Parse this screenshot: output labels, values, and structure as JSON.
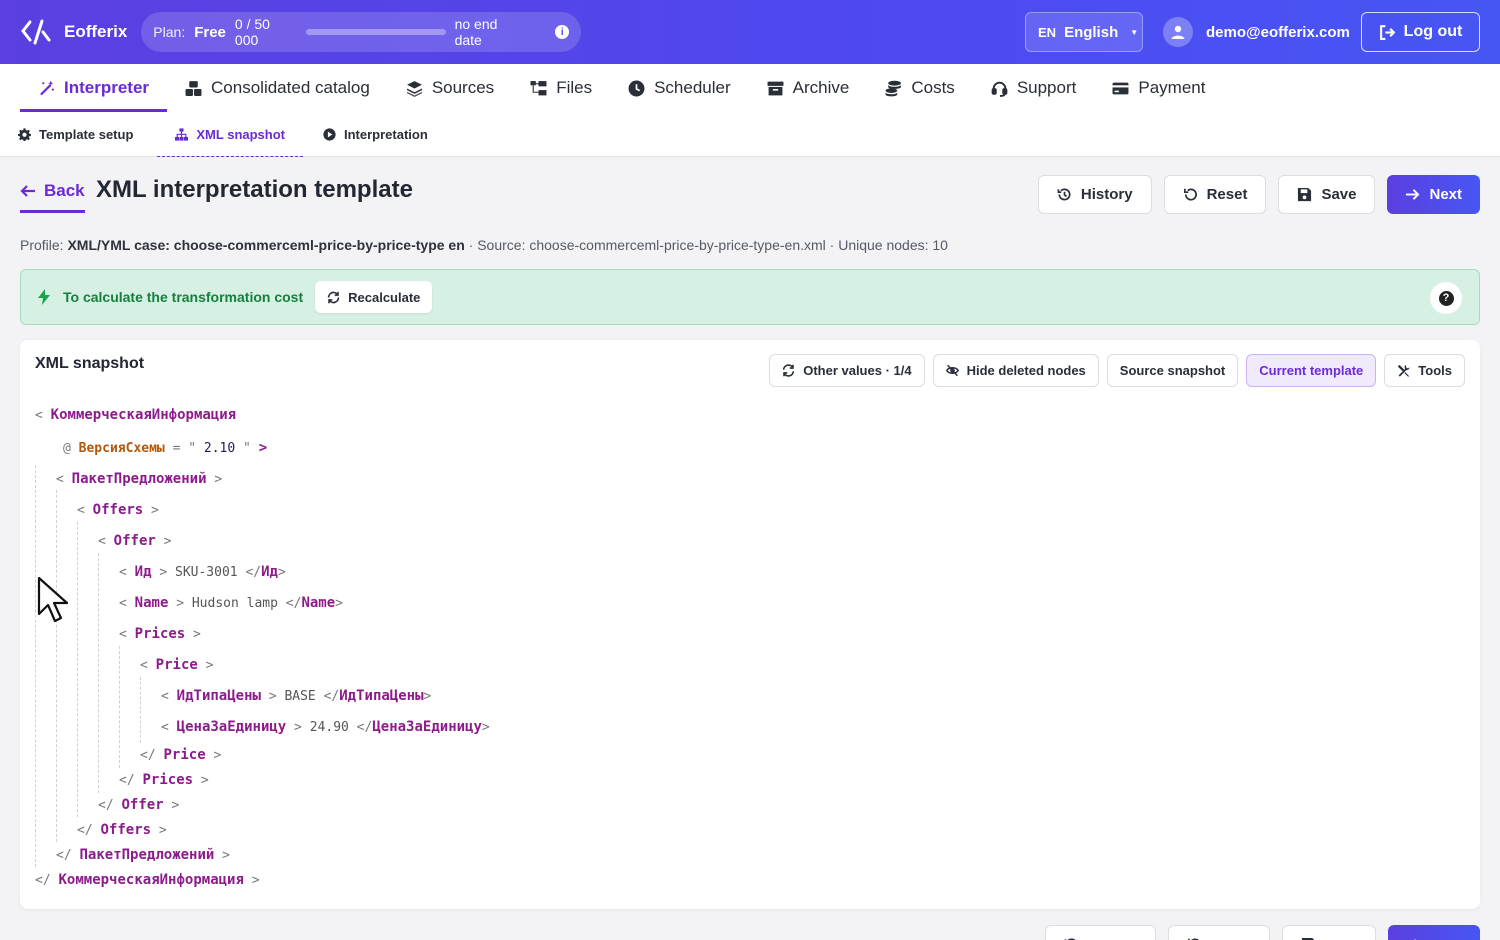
{
  "header": {
    "app_name": "Eofferix",
    "plan_label": "Plan:",
    "plan_name": "Free",
    "usage": "0 / 50 000",
    "usage_fraction": 0,
    "expiry": "no end date",
    "lang_code": "EN",
    "lang_name": "English",
    "user_email": "demo@eofferix.com",
    "logout_label": "Log out"
  },
  "main_nav": [
    {
      "label": "Interpreter",
      "icon": "magic-wand-icon",
      "active": true
    },
    {
      "label": "Consolidated catalog",
      "icon": "cubes-icon"
    },
    {
      "label": "Sources",
      "icon": "layers-icon"
    },
    {
      "label": "Files",
      "icon": "folder-tree-icon"
    },
    {
      "label": "Scheduler",
      "icon": "clock-icon"
    },
    {
      "label": "Archive",
      "icon": "archive-box-icon"
    },
    {
      "label": "Costs",
      "icon": "coins-icon"
    },
    {
      "label": "Support",
      "icon": "headset-icon"
    },
    {
      "label": "Payment",
      "icon": "credit-card-icon"
    }
  ],
  "sub_nav": [
    {
      "label": "Template setup",
      "icon": "gear-icon"
    },
    {
      "label": "XML snapshot",
      "icon": "sitemap-icon",
      "active": true
    },
    {
      "label": "Interpretation",
      "icon": "play-circle-icon"
    }
  ],
  "page": {
    "back_label": "Back",
    "title": "XML interpretation template",
    "actions": {
      "history": "History",
      "reset": "Reset",
      "save": "Save",
      "next": "Next"
    },
    "profile_label": "Profile:",
    "profile_value": "XML/YML case: choose-commerceml-price-by-price-type en",
    "source_text": "· Source: choose-commerceml-price-by-price-type-en.xml · Unique nodes: 10"
  },
  "alert": {
    "text": "To calculate the transformation cost",
    "button": "Recalculate",
    "color": "#15803d"
  },
  "snapshot": {
    "title": "XML snapshot",
    "toolbar": {
      "other_values": "Other values · 1/4",
      "hide_deleted": "Hide deleted nodes",
      "source_snapshot": "Source snapshot",
      "current_template": "Current template",
      "tools": "Tools"
    },
    "xml": {
      "root": "КоммерческаяИнформация",
      "attr_name": "ВерсияСхемы",
      "attr_value": "2.10",
      "package": "ПакетПредложений",
      "offers": "Offers",
      "offer": "Offer",
      "id_tag": "Ид",
      "id_value": "SKU-3001",
      "name_tag": "Name",
      "name_value": "Hudson lamp",
      "prices": "Prices",
      "price": "Price",
      "price_type_tag": "ИдТипаЦены",
      "price_type_value": "BASE",
      "unit_price_tag": "ЦенаЗаЕдиницу",
      "unit_price_value": "24.90"
    }
  },
  "colors": {
    "accent": "#6a2ad8",
    "header_gradient_start": "#5b3fe0",
    "header_gradient_end": "#4756f3",
    "xml_tag": "#8c1b8c",
    "xml_attr": "#b05a10"
  }
}
